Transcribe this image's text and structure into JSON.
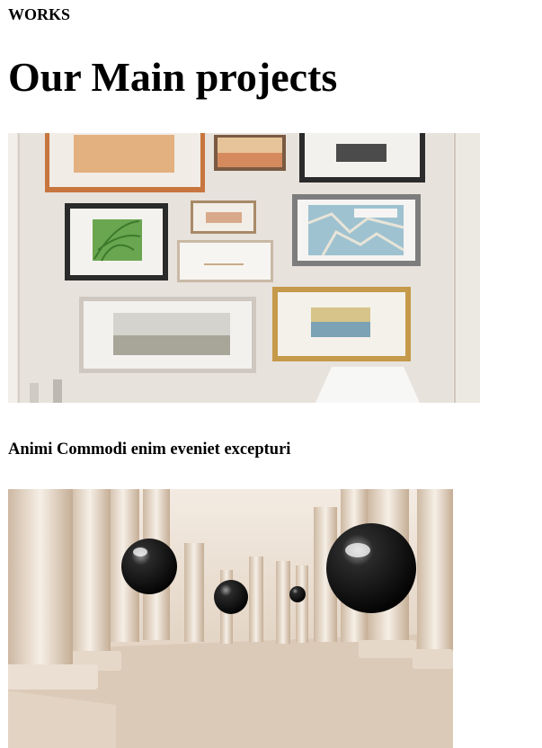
{
  "section": {
    "eyebrow": "WORKS",
    "heading": "Our Main projects"
  },
  "projects": [
    {
      "image": "gallery-wall-photo",
      "title": "Animi Commodi enim eveniet excepturi"
    },
    {
      "image": "columns-spheres-photo"
    }
  ]
}
